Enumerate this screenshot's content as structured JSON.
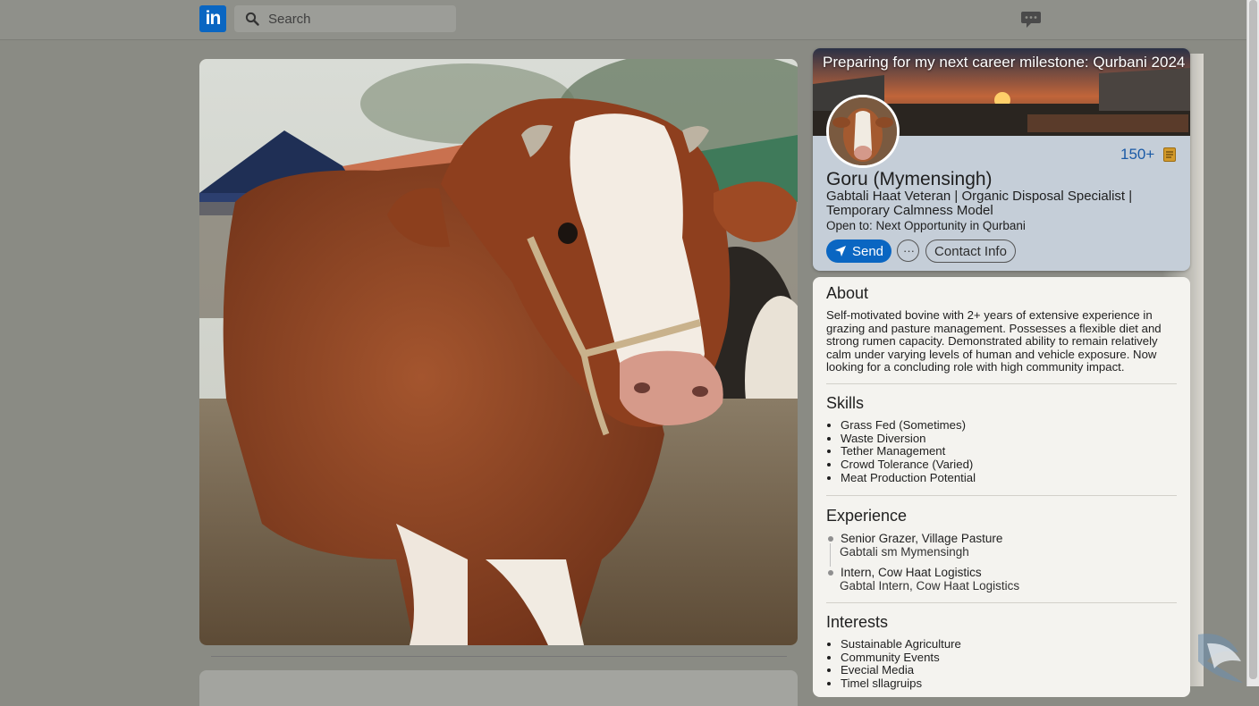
{
  "topbar": {
    "logo_text": "in",
    "search_placeholder": "Search",
    "icons": [
      "linkedin-logo",
      "search-icon",
      "messaging-icon"
    ]
  },
  "profile": {
    "banner_title": "Preparing for my next career milestone: Qurbani 2024",
    "connections": "150+",
    "name": "Goru (Mymensingh)",
    "headline": "Gabtali Haat Veteran | Organic Disposal Specialist | Temporary Calmness Model",
    "open_to": "Open to: Next Opportunity in Qurbani",
    "send_label": "Send",
    "more_label": "···",
    "contact_label": "Contact Info"
  },
  "about": {
    "title": "About",
    "text": "Self-motivated bovine with 2+ years of extensive experience in grazing and pasture management. Possesses a flexible diet and strong rumen capacity. Demonstrated ability to remain relatively calm under varying levels of human and vehicle exposure. Now looking for a concluding role with high community impact."
  },
  "skills": {
    "title": "Skills",
    "items": [
      "Grass Fed (Sometimes)",
      "Waste Diversion",
      "Tether Management",
      "Crowd Tolerance (Varied)",
      "Meat Production Potential"
    ]
  },
  "experience": {
    "title": "Experience",
    "items": [
      {
        "title": "Senior Grazer, Village Pasture",
        "sub": "Gabtali sm Mymensingh"
      },
      {
        "title": "Intern, Cow Haat Logistics",
        "sub": "Gabtal Intern, Cow Haat Logistics"
      }
    ]
  },
  "interests": {
    "title": "Interests",
    "items": [
      "Sustainable Agriculture",
      "Community Events",
      "Evecial Media",
      "Timel sllagruips"
    ]
  },
  "colors": {
    "brand_blue": "#0a66c2",
    "page_bg": "#8a8b84",
    "profile_card_bg": "#c5ced8",
    "about_card_bg": "#f4f3ef"
  }
}
